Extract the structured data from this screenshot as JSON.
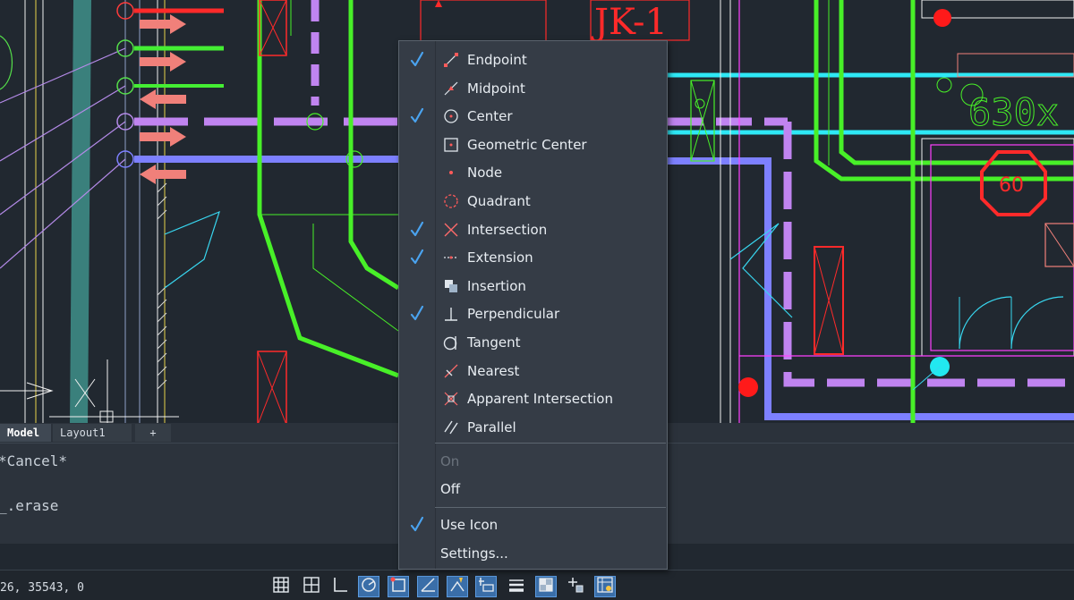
{
  "drawing": {
    "labels": {
      "jk": "JK-1",
      "duct": "630x",
      "damper": "60"
    }
  },
  "layout_tabs": [
    {
      "label": "Model",
      "active": true
    },
    {
      "label": "Layout1",
      "active": false
    },
    {
      "label": "+",
      "active": false
    }
  ],
  "command_history": [
    "*Cancel*",
    "_.erase"
  ],
  "status": {
    "coordinates": "26, 35543, 0"
  },
  "status_buttons": [
    {
      "icon": "grid-icon",
      "on": false
    },
    {
      "icon": "snap-grid-icon",
      "on": false
    },
    {
      "icon": "ortho-icon",
      "on": false
    },
    {
      "icon": "polar-tracking-icon",
      "on": true
    },
    {
      "icon": "object-snap-icon",
      "on": true
    },
    {
      "icon": "object-snap-tracking-icon",
      "on": true
    },
    {
      "icon": "dynamic-ucs-icon",
      "on": true
    },
    {
      "icon": "dynamic-input-icon",
      "on": true
    },
    {
      "icon": "lineweight-icon",
      "on": false
    },
    {
      "icon": "transparency-icon",
      "on": true
    },
    {
      "icon": "selection-cycling-icon",
      "on": false
    },
    {
      "icon": "annotation-monitor-icon",
      "on": true
    }
  ],
  "osnap_menu": {
    "items": [
      {
        "label": "Endpoint",
        "checked": true,
        "icon": "endpoint-icon"
      },
      {
        "label": "Midpoint",
        "checked": false,
        "icon": "midpoint-icon"
      },
      {
        "label": "Center",
        "checked": true,
        "icon": "center-icon"
      },
      {
        "label": "Geometric Center",
        "checked": false,
        "icon": "geometric-center-icon"
      },
      {
        "label": "Node",
        "checked": false,
        "icon": "node-icon"
      },
      {
        "label": "Quadrant",
        "checked": false,
        "icon": "quadrant-icon"
      },
      {
        "label": "Intersection",
        "checked": true,
        "icon": "intersection-icon"
      },
      {
        "label": "Extension",
        "checked": true,
        "icon": "extension-icon"
      },
      {
        "label": "Insertion",
        "checked": false,
        "icon": "insertion-icon"
      },
      {
        "label": "Perpendicular",
        "checked": true,
        "icon": "perpendicular-icon"
      },
      {
        "label": "Tangent",
        "checked": false,
        "icon": "tangent-icon"
      },
      {
        "label": "Nearest",
        "checked": false,
        "icon": "nearest-icon"
      },
      {
        "label": "Apparent Intersection",
        "checked": false,
        "icon": "apparent-intersection-icon"
      },
      {
        "label": "Parallel",
        "checked": false,
        "icon": "parallel-icon"
      }
    ],
    "on_label": "On",
    "off_label": "Off",
    "use_icon_label": "Use Icon",
    "use_icon_checked": true,
    "settings_label": "Settings..."
  },
  "colors": {
    "check": "#4aa3ef",
    "menu_bg": "#353c46",
    "accent_on": "#3a6ea8"
  }
}
